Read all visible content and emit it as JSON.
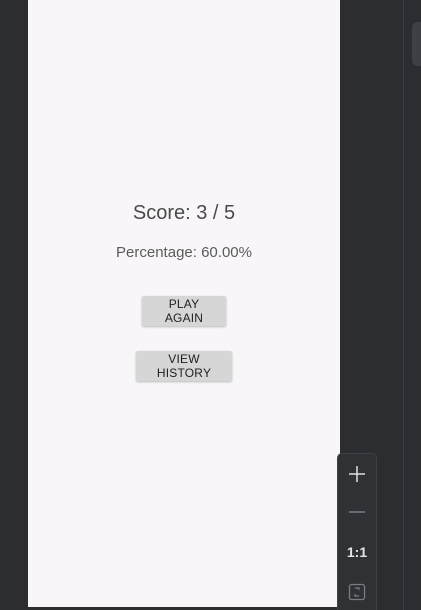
{
  "result": {
    "score_text": "Score: 3 / 5",
    "percentage_text": "Percentage: 60.00%"
  },
  "buttons": {
    "play_again": "PLAY AGAIN",
    "view_history": "VIEW HISTORY"
  },
  "zoom_controls": {
    "zoom_in_icon": "plus-icon",
    "zoom_out_icon": "minus-icon",
    "reset_label": "1:1",
    "fit_icon": "fit-screen-icon"
  },
  "colors": {
    "screen_background": "#f8f6f9",
    "ide_background": "#2b2d30",
    "button_background": "#d6d6d6"
  }
}
